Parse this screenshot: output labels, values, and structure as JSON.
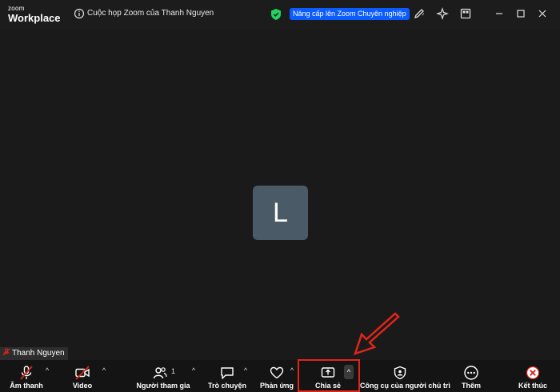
{
  "app": {
    "logo_line1": "zoom",
    "logo_line2": "Workplace"
  },
  "titlebar": {
    "meeting_title": "Cuộc họp Zoom của Thanh Nguyen",
    "upgrade_label": "Nâng cấp lên Zoom Chuyên nghiệp",
    "accent_color": "#0b5cff"
  },
  "stage": {
    "avatar_letter": "L",
    "participant_name": "Thanh Nguyen"
  },
  "toolbar": {
    "audio_label": "Âm thanh",
    "video_label": "Video",
    "participants_label": "Người tham gia",
    "participants_count": "1",
    "chat_label": "Trò chuyện",
    "reactions_label": "Phản ứng",
    "share_label": "Chia sẻ",
    "host_tools_label": "Công cụ của người chủ trì",
    "more_label": "Thêm",
    "end_label": "Kết thúc",
    "caret_glyph": "^"
  },
  "annotation": {
    "highlight_color": "#e1251b"
  },
  "icons": [
    "info-icon",
    "shield-icon",
    "pen-icon",
    "sparkle-icon",
    "apps-icon",
    "minimize-icon",
    "maximize-icon",
    "close-icon",
    "mic-muted-icon",
    "video-off-icon",
    "participants-icon",
    "chat-icon",
    "heart-icon",
    "share-screen-icon",
    "shield-host-icon",
    "more-dots-icon",
    "end-icon"
  ]
}
